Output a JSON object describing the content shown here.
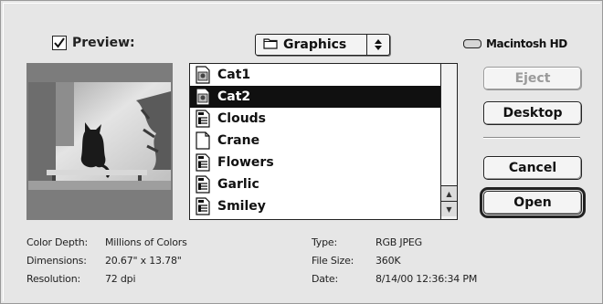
{
  "dialog": {
    "preview_label": "Preview:",
    "preview_checked": true,
    "location_folder": "Graphics",
    "volume_name": "Macintosh HD"
  },
  "files": [
    {
      "name": "Cat1",
      "icon": "image-file-icon",
      "selected": false
    },
    {
      "name": "Cat2",
      "icon": "image-file-icon",
      "selected": true
    },
    {
      "name": "Clouds",
      "icon": "graphic-document-icon",
      "selected": false
    },
    {
      "name": "Crane",
      "icon": "blank-document-icon",
      "selected": false
    },
    {
      "name": "Flowers",
      "icon": "graphic-document-icon",
      "selected": false
    },
    {
      "name": "Garlic",
      "icon": "graphic-document-icon",
      "selected": false
    },
    {
      "name": "Smiley",
      "icon": "graphic-document-icon",
      "selected": false
    }
  ],
  "buttons": {
    "eject": "Eject",
    "desktop": "Desktop",
    "cancel": "Cancel",
    "open": "Open"
  },
  "info": {
    "color_depth_label": "Color Depth:",
    "color_depth_value": "Millions of Colors",
    "dimensions_label": "Dimensions:",
    "dimensions_value": "20.67\" x 13.78\"",
    "resolution_label": "Resolution:",
    "resolution_value": "72 dpi",
    "type_label": "Type:",
    "type_value": "RGB JPEG",
    "file_size_label": "File Size:",
    "file_size_value": "360K",
    "date_label": "Date:",
    "date_value": "8/14/00 12:36:34 PM"
  },
  "colors": {
    "window_bg": "#e6e6e6",
    "selection": "#101010",
    "preview_bg": "#7c7c7c"
  }
}
